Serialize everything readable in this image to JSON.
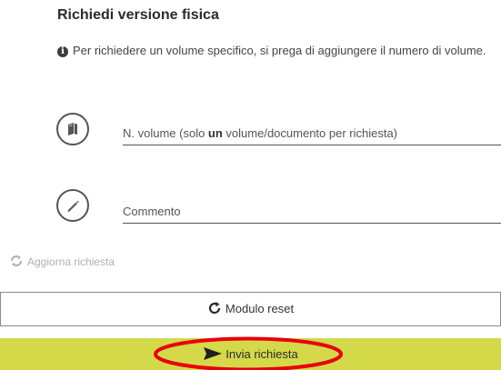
{
  "form": {
    "title": "Richiedi versione fisica",
    "info_text": "Per richiedere un volume specifico, si prega di aggiungere il numero di volume.",
    "volume_field": {
      "placeholder_before": "N. volume (solo ",
      "placeholder_bold": "un",
      "placeholder_after": " volume/documento per richiesta)",
      "value": ""
    },
    "comment_field": {
      "placeholder": "Commento",
      "value": ""
    }
  },
  "actions": {
    "update_label": "Aggiorna richiesta",
    "reset_label": "Modulo reset",
    "send_label": "Invia richiesta"
  },
  "colors": {
    "send_button": "#d4d94a",
    "highlight": "#e8000b",
    "update_disabled": "#b0b0b0"
  },
  "icons": {
    "info": "info-circle-icon",
    "volume": "book-icon",
    "comment": "pencil-icon",
    "update": "refresh-icon",
    "reset": "reset-icon",
    "send": "send-arrow-icon"
  }
}
